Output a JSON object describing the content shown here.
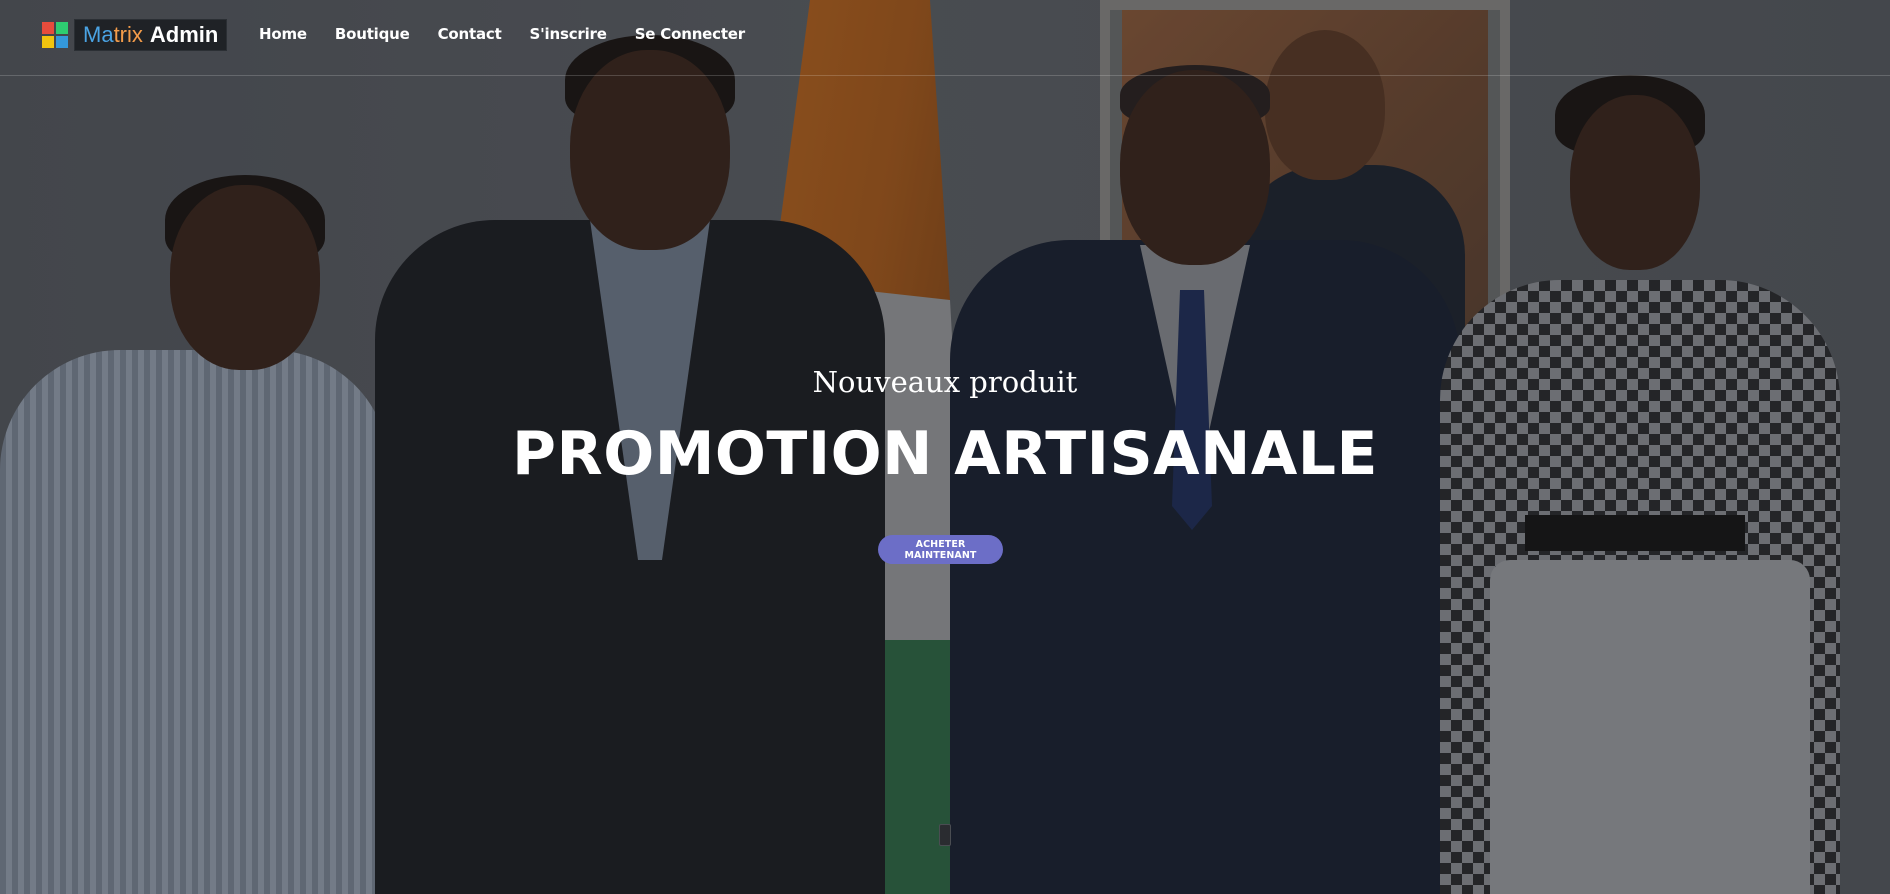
{
  "brand": {
    "part_a": "Ma",
    "part_b": "trix",
    "part_c": "Admin",
    "logo_colors": [
      "#e74c3c",
      "#2ecc71",
      "#f1c40f",
      "#3498db"
    ]
  },
  "nav": {
    "items": [
      {
        "label": "Home"
      },
      {
        "label": "Boutique"
      },
      {
        "label": "Contact"
      },
      {
        "label": "S'inscrire"
      },
      {
        "label": "Se Connecter"
      }
    ]
  },
  "hero": {
    "subtitle": "Nouveaux produit",
    "title": "PROMOTION ARTISANALE",
    "cta_label": "ACHETER MAINTENANT"
  },
  "colors": {
    "cta_bg": "#6c6ec7",
    "text": "#ffffff"
  }
}
